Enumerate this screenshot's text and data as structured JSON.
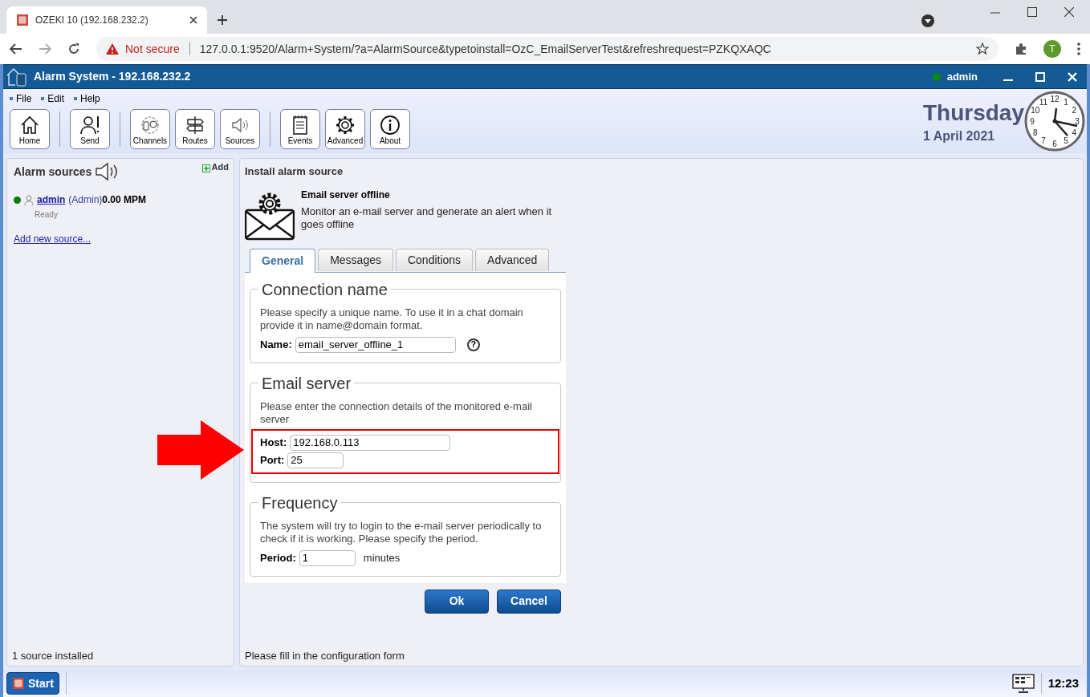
{
  "browser": {
    "tab_title": "OZEKI 10 (192.168.232.2)",
    "security": "Not secure",
    "url": "127.0.0.1:9520/Alarm+System/?a=AlarmSource&typetoinstall=OzC_EmailServerTest&refreshrequest=PZKQXAQC",
    "profile": "T"
  },
  "app": {
    "title": "Alarm System - 192.168.232.2",
    "user": "admin",
    "user_online": true
  },
  "menu": [
    "File",
    "Edit",
    "Help"
  ],
  "toolbar": [
    [
      "Home"
    ],
    [
      "Send"
    ],
    [
      "Channels",
      "Routes",
      "Sources"
    ],
    [
      "Events",
      "Advanced",
      "About"
    ]
  ],
  "date": {
    "day": "Thursday",
    "date": "1 April 2021"
  },
  "clock_numbers": [
    "12",
    "11",
    "1",
    "10",
    "2",
    "9",
    "3",
    "8",
    "4",
    "7",
    "5",
    "6"
  ],
  "sidebar": {
    "title": "Alarm sources",
    "add": "Add",
    "sources": [
      {
        "name": "admin",
        "role": "(Admin)",
        "rate": "0.00 MPM",
        "status": "Ready",
        "online": true
      }
    ],
    "add_link": "Add new source...",
    "footer": "1 source installed"
  },
  "main": {
    "title": "Install alarm source",
    "source_title": "Email server offline",
    "source_desc": "Monitor an e-mail server and generate an alert when it goes offline",
    "tabs": [
      {
        "label": "General",
        "selected": true
      },
      {
        "label": "Messages",
        "selected": false
      },
      {
        "label": "Conditions",
        "selected": false
      },
      {
        "label": "Advanced",
        "selected": false
      }
    ],
    "sections": [
      {
        "legend": "Connection name",
        "text": "Please specify a unique name. To use it in a chat domain provide it in name@domain format.",
        "fields": [
          {
            "label": "Name:",
            "value": "email_server_offline_1",
            "help": "?"
          }
        ]
      },
      {
        "legend": "Email server",
        "text": "Please enter the connection details of the monitored e-mail server",
        "highlighted": true,
        "fields": [
          {
            "label": "Host:",
            "value": "192.168.0.113"
          },
          {
            "label": "Port:",
            "value": "25"
          }
        ]
      },
      {
        "legend": "Frequency",
        "text": "The system will try to login to the e-mail server periodically to check if it is working. Please specify the period.",
        "fields": [
          {
            "label": "Period:",
            "value": "1",
            "unit": "minutes"
          }
        ]
      }
    ],
    "buttons": [
      "Ok",
      "Cancel"
    ],
    "status": "Please fill in the configuration form"
  },
  "taskbar": {
    "start": "Start",
    "time": "12:23"
  }
}
